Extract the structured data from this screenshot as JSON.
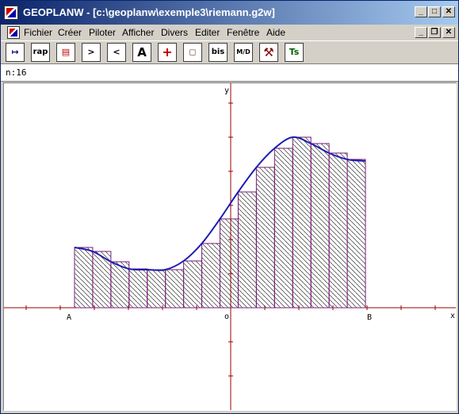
{
  "window": {
    "title": "GEOPLANW - [c:\\geoplanw\\exemple3\\riemann.g2w]",
    "controls": {
      "minimize": "_",
      "maximize": "□",
      "close": "✕"
    }
  },
  "menubar": {
    "items": [
      "Fichier",
      "Créer",
      "Piloter",
      "Afficher",
      "Divers",
      "Editer",
      "Fenêtre",
      "Aide"
    ],
    "doc_controls": {
      "minimize": "_",
      "restore": "❐",
      "close": "✕"
    }
  },
  "toolbar": {
    "buttons": [
      {
        "name": "execute-arrow-icon",
        "label": "↦"
      },
      {
        "name": "rap-button",
        "label": "rap"
      },
      {
        "name": "palette-icon",
        "label": "▤"
      },
      {
        "name": "next-icon",
        "label": ">"
      },
      {
        "name": "previous-icon",
        "label": "<"
      },
      {
        "name": "text-a-icon",
        "label": "A"
      },
      {
        "name": "axes-icon",
        "label": "+"
      },
      {
        "name": "frame-icon",
        "label": "◻"
      },
      {
        "name": "bis-button",
        "label": "bis"
      },
      {
        "name": "md-icon",
        "label": "M/D"
      },
      {
        "name": "hammer-icon",
        "label": "⚒"
      },
      {
        "name": "ts-icon",
        "label": "Ts"
      }
    ]
  },
  "status": {
    "text": "n:16"
  },
  "graph": {
    "labels": {
      "y_axis": "y",
      "x_axis": "x",
      "origin": "o",
      "point_a": "A",
      "point_b": "B"
    },
    "colors": {
      "axis": "#990000",
      "curve": "#1c1cb0",
      "rect": "#7a1a7a",
      "hatch": "#333333"
    },
    "n_rectangles": 16,
    "rectangle_heights": [
      76,
      71,
      58,
      49,
      48,
      48,
      59,
      81,
      112,
      146,
      177,
      201,
      215,
      207,
      195,
      187
    ]
  }
}
